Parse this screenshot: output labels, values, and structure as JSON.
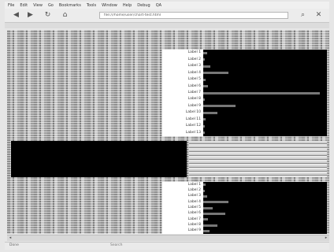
{
  "menu": [
    "File",
    "Edit",
    "View",
    "Go",
    "Bookmarks",
    "Tools",
    "Window",
    "Help",
    "Debug",
    "QA"
  ],
  "toolbar": {
    "back_icon": "arrow-left-icon",
    "forward_icon": "arrow-right-icon",
    "reload_icon": "reload-icon",
    "home_icon": "home-icon",
    "url": "file:///home/user/chart-test.html",
    "search_icon": "search-icon",
    "stop_icon": "stop-icon"
  },
  "chart_top": {
    "labels": [
      "Label 1",
      "Label 2",
      "Label 3",
      "Label 4",
      "Label 5",
      "Label 6",
      "Label 7",
      "Label 8",
      "Label 9",
      "Label 10",
      "Label 11",
      "Label 12",
      "Label 13"
    ],
    "bar_values": [
      0.03,
      0.01,
      0.06,
      0.21,
      0.02,
      0.04,
      0.97,
      0.01,
      0.27,
      0.12,
      0.02,
      0.01,
      0.01
    ]
  },
  "chart_bottom": {
    "labels": [
      "Label 1",
      "Label 2",
      "Label 3",
      "Label 4",
      "Label 5",
      "Label 6",
      "Label 7",
      "Label 8",
      "Label 9"
    ],
    "bar_values": [
      0.02,
      0.01,
      0.03,
      0.21,
      0.08,
      0.18,
      0.04,
      0.12,
      0.05
    ]
  },
  "status": {
    "left": "Done",
    "center": "Search"
  }
}
